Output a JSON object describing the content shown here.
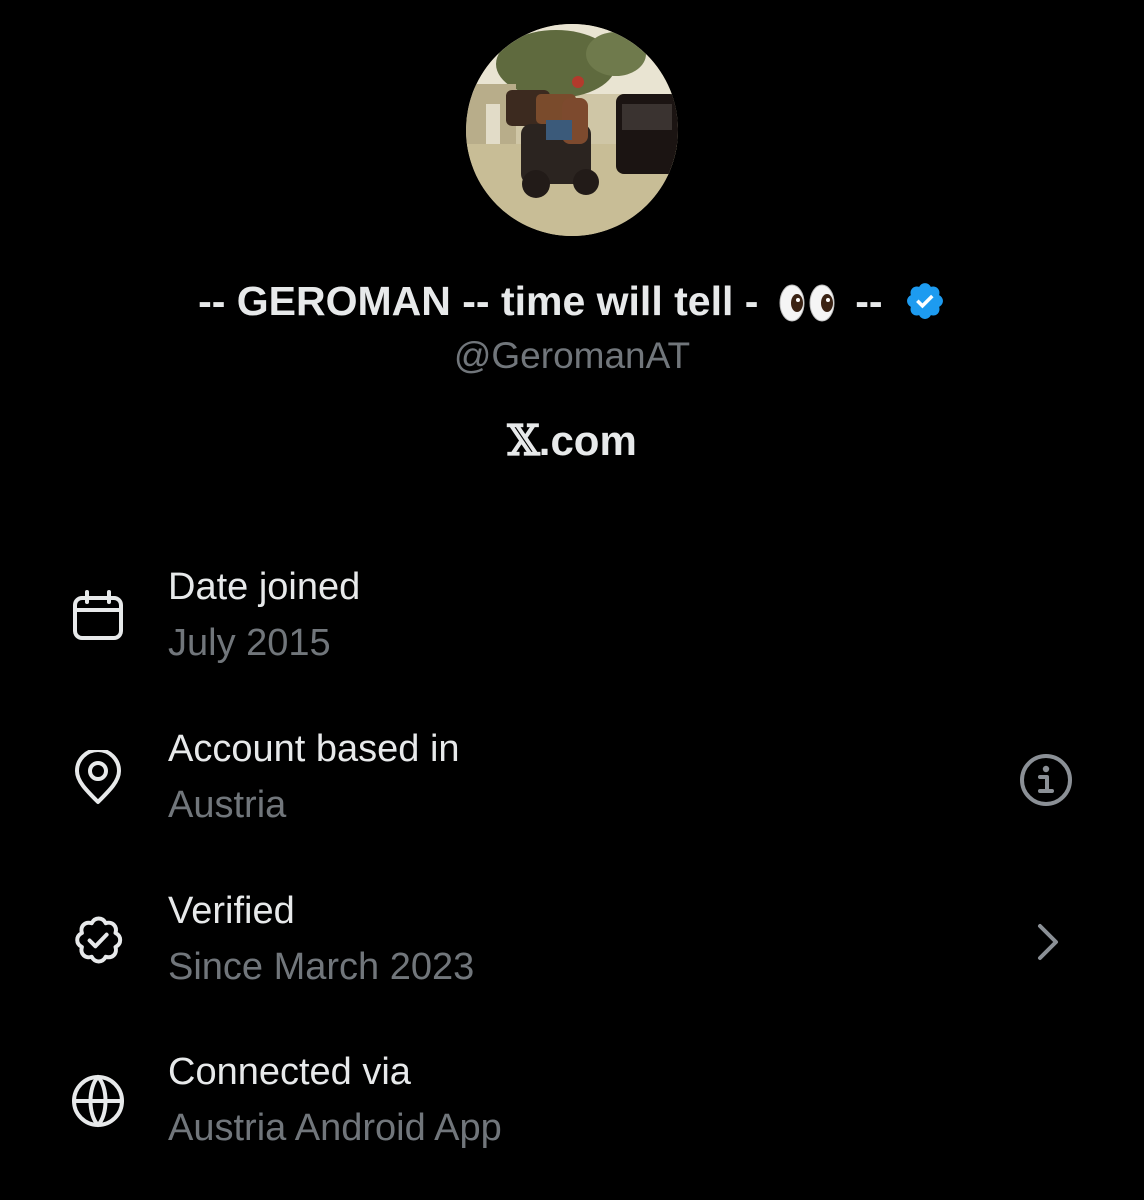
{
  "profile": {
    "display_name_prefix": "-- GEROMAN -- time will tell -",
    "display_name_suffix": "--",
    "handle": "@GeromanAT",
    "site_prefix": "𝕏",
    "site_suffix": ".com"
  },
  "details": [
    {
      "label": "Date joined",
      "value": "July 2015",
      "icon": "calendar-icon"
    },
    {
      "label": "Account based in",
      "value": "Austria",
      "icon": "location-pin-icon",
      "action_icon": "info-icon"
    },
    {
      "label": "Verified",
      "value": "Since March 2023",
      "icon": "verified-badge-outline-icon",
      "action_icon": "chevron-right-icon"
    },
    {
      "label": "Connected via",
      "value": "Austria Android App",
      "icon": "globe-icon"
    }
  ],
  "colors": {
    "background": "#000000",
    "primary_text": "#e7e9ea",
    "secondary_text": "#71767b",
    "verified_blue": "#1d9bf0"
  }
}
